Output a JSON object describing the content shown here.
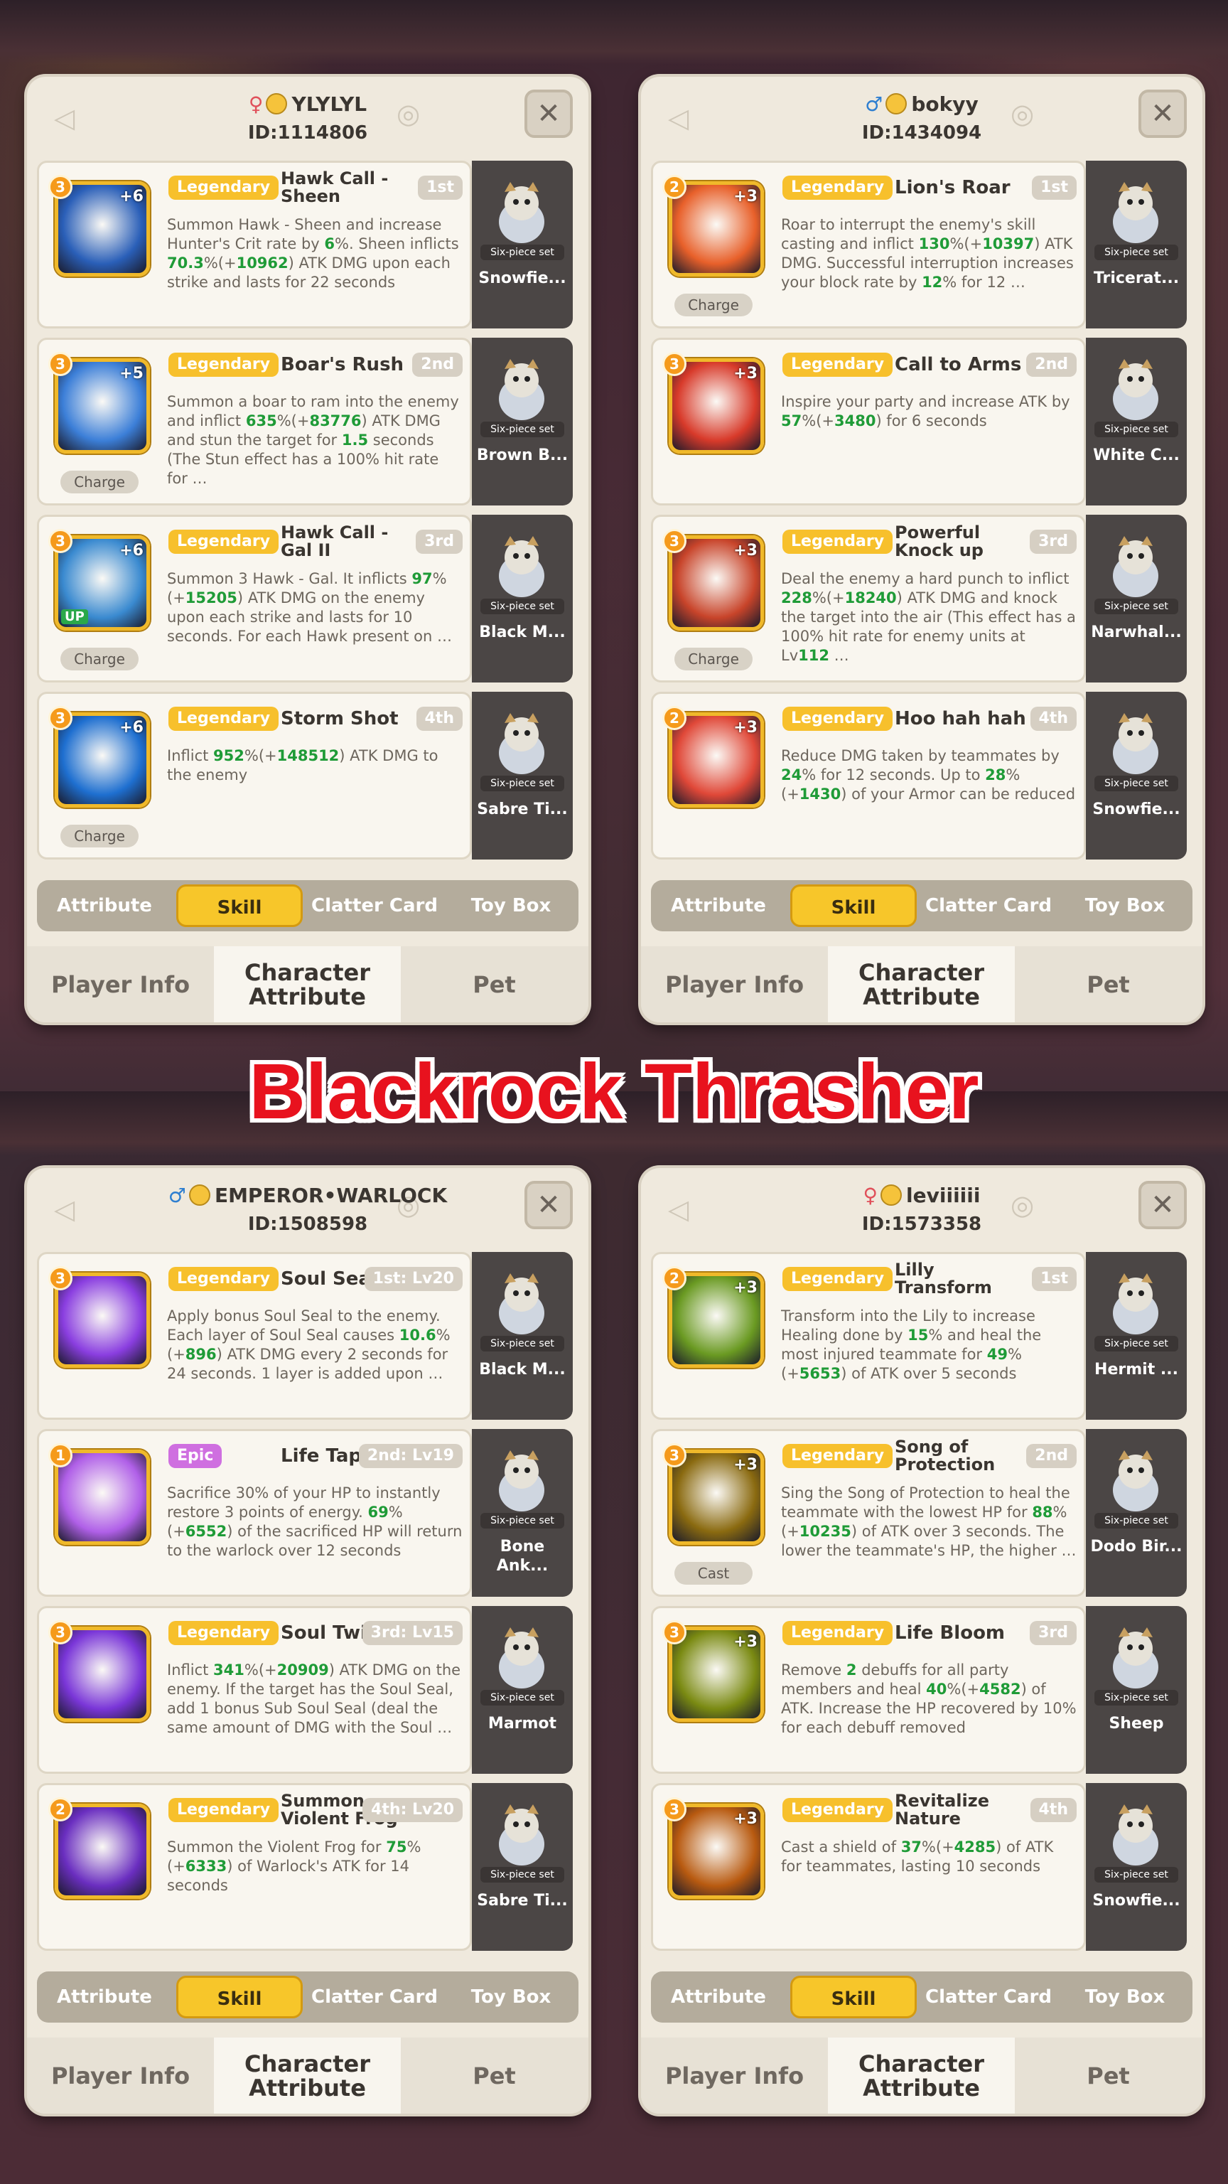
{
  "title_banner": "Blackrock Thrasher",
  "colors": {
    "legendary": "#f7c02c",
    "epic": "#cf6fe0",
    "active_tab": "#f7c62a",
    "highlight_green": "#1f9b37",
    "title_red": "#e8121e"
  },
  "tabs": [
    "Attribute",
    "Skill",
    "Clatter Card",
    "Toy Box"
  ],
  "bottom_tabs": [
    "Player Info",
    "Character Attribute",
    "Pet"
  ],
  "pet_label": "Six-piece set",
  "panels": [
    {
      "gender": "female",
      "player_name": "YLYLYL",
      "player_id": "ID:1114806",
      "skills": [
        {
          "level": "3",
          "plus": "+6",
          "rarity": "Legendary",
          "name": "Hawk Call - Sheen",
          "rank": "1st",
          "chip": "",
          "desc": [
            [
              "Summon Hawk - Sheen and increase Hunter's Crit rate by ",
              ""
            ],
            [
              "6",
              "g"
            ],
            [
              "%. Sheen inflicts ",
              ""
            ],
            [
              "70.3",
              "g"
            ],
            [
              "%(+",
              ""
            ],
            [
              "10962",
              "g"
            ],
            [
              ") ATK DMG upon each strike and lasts for 22 seconds",
              ""
            ]
          ],
          "pet": "Snowfie...",
          "icon_color": "#2a5fb8"
        },
        {
          "level": "3",
          "plus": "+5",
          "rarity": "Legendary",
          "name": "Boar's Rush",
          "rank": "2nd",
          "chip": "Charge",
          "desc": [
            [
              "Summon a boar to ram into the enemy and inflict ",
              ""
            ],
            [
              "635",
              "g"
            ],
            [
              "%(+",
              ""
            ],
            [
              "83776",
              "g"
            ],
            [
              ") ATK DMG and stun the target for ",
              ""
            ],
            [
              "1.5",
              "g"
            ],
            [
              " seconds (The Stun effect has a 100% hit rate for …",
              ""
            ]
          ],
          "pet": "Brown B...",
          "icon_color": "#3c7fd8"
        },
        {
          "level": "3",
          "plus": "+6",
          "rarity": "Legendary",
          "name": "Hawk Call - Gal II",
          "rank": "3rd",
          "chip": "Charge",
          "up": "UP",
          "desc": [
            [
              "Summon 3 Hawk - Gal. It inflicts ",
              ""
            ],
            [
              "97",
              "g"
            ],
            [
              "%(+",
              ""
            ],
            [
              "15205",
              "g"
            ],
            [
              ") ATK DMG on the enemy upon each strike and lasts for 10 seconds. For each Hawk present on …",
              ""
            ]
          ],
          "pet": "Black M...",
          "icon_color": "#3a8ad0"
        },
        {
          "level": "3",
          "plus": "+6",
          "rarity": "Legendary",
          "name": "Storm Shot",
          "rank": "4th",
          "chip": "Charge",
          "desc": [
            [
              "Inflict ",
              ""
            ],
            [
              "952",
              "g"
            ],
            [
              "%(+",
              ""
            ],
            [
              "148512",
              "g"
            ],
            [
              ") ATK DMG to the enemy",
              ""
            ]
          ],
          "pet": "Sabre Ti...",
          "icon_color": "#1e6fd0"
        }
      ]
    },
    {
      "gender": "male",
      "player_name": "bokyy",
      "player_id": "ID:1434094",
      "skills": [
        {
          "level": "2",
          "plus": "+3",
          "rarity": "Legendary",
          "name": "Lion's Roar",
          "rank": "1st",
          "chip": "Charge",
          "desc": [
            [
              "Roar to interrupt the enemy's skill casting and inflict ",
              ""
            ],
            [
              "130",
              "g"
            ],
            [
              "%(+",
              ""
            ],
            [
              "10397",
              "g"
            ],
            [
              ") ATK DMG. Successful interruption increases your block rate by ",
              ""
            ],
            [
              "12",
              "g"
            ],
            [
              "% for 12 …",
              ""
            ]
          ],
          "pet": "Tricerat...",
          "icon_color": "#e8602a"
        },
        {
          "level": "3",
          "plus": "+3",
          "rarity": "Legendary",
          "name": "Call to Arms",
          "rank": "2nd",
          "chip": "",
          "desc": [
            [
              "Inspire your party and increase ATK by ",
              ""
            ],
            [
              "57",
              "g"
            ],
            [
              "%(+",
              ""
            ],
            [
              "3480",
              "g"
            ],
            [
              ") for 6 seconds",
              ""
            ]
          ],
          "pet": "White C...",
          "icon_color": "#d83a2a"
        },
        {
          "level": "3",
          "plus": "+3",
          "rarity": "Legendary",
          "name": "Powerful Knock up",
          "rank": "3rd",
          "chip": "Charge",
          "desc": [
            [
              "Deal the enemy a hard punch to inflict ",
              ""
            ],
            [
              "228",
              "g"
            ],
            [
              "%(+",
              ""
            ],
            [
              "18240",
              "g"
            ],
            [
              ") ATK DMG and knock the target into the air (This effect has a 100% hit rate for enemy units at Lv",
              ""
            ],
            [
              "112",
              "g"
            ],
            [
              " …",
              ""
            ]
          ],
          "pet": "Narwhal...",
          "icon_color": "#c8442a"
        },
        {
          "level": "2",
          "plus": "+3",
          "rarity": "Legendary",
          "name": "Hoo hah hah",
          "rank": "4th",
          "chip": "",
          "desc": [
            [
              "Reduce DMG taken by teammates by ",
              ""
            ],
            [
              "24",
              "g"
            ],
            [
              "% for 12 seconds. Up to ",
              ""
            ],
            [
              "28",
              "g"
            ],
            [
              "%(+",
              ""
            ],
            [
              "1430",
              "g"
            ],
            [
              ") of your Armor can be reduced",
              ""
            ]
          ],
          "pet": "Snowfie...",
          "icon_color": "#e04838"
        }
      ]
    },
    {
      "gender": "male",
      "player_name": "EMPEROR•WARLOCK",
      "player_id": "ID:1508598",
      "skills": [
        {
          "level": "3",
          "plus": "",
          "rarity": "Legendary",
          "name": "Soul Seal",
          "rank": "1st: Lv20",
          "chip": "",
          "desc": [
            [
              "Apply bonus Soul Seal to the enemy. Each layer of Soul Seal causes ",
              ""
            ],
            [
              "10.6",
              "g"
            ],
            [
              "%(+",
              ""
            ],
            [
              "896",
              "g"
            ],
            [
              ") ATK DMG every 2 seconds for 24 seconds. 1 layer is added upon …",
              ""
            ]
          ],
          "pet": "Black M...",
          "icon_color": "#8a3ee0"
        },
        {
          "level": "1",
          "plus": "",
          "rarity": "Epic",
          "name": "Life Tap",
          "rank": "2nd: Lv19",
          "chip": "",
          "desc": [
            [
              "Sacrifice 30% of your HP to instantly restore 3 points of energy. ",
              ""
            ],
            [
              "69",
              "g"
            ],
            [
              "%(+",
              ""
            ],
            [
              "6552",
              "g"
            ],
            [
              ") of the sacrificed HP will return to the warlock over 12 seconds",
              ""
            ]
          ],
          "pet": "Bone Ank...",
          "icon_color": "#b060e8"
        },
        {
          "level": "3",
          "plus": "",
          "rarity": "Legendary",
          "name": "Soul Twins",
          "rank": "3rd: Lv15",
          "chip": "",
          "desc": [
            [
              "Inflict ",
              ""
            ],
            [
              "341",
              "g"
            ],
            [
              "%(+",
              ""
            ],
            [
              "20909",
              "g"
            ],
            [
              ") ATK DMG on the enemy. If the target has the Soul Seal, add 1 bonus Sub Soul Seal (deal the same amount of DMG with the Soul …",
              ""
            ]
          ],
          "pet": "Marmot",
          "icon_color": "#7a36d8"
        },
        {
          "level": "2",
          "plus": "",
          "rarity": "Legendary",
          "name": "Summon Violent Frog",
          "rank": "4th: Lv20",
          "chip": "",
          "desc": [
            [
              "Summon the Violent Frog for ",
              ""
            ],
            [
              "75",
              "g"
            ],
            [
              "%(+",
              ""
            ],
            [
              "6333",
              "g"
            ],
            [
              ") of Warlock's ATK for 14 seconds",
              ""
            ]
          ],
          "pet": "Sabre Ti...",
          "icon_color": "#6a2ec0"
        }
      ]
    },
    {
      "gender": "female",
      "player_name": "leviiiiii",
      "player_id": "ID:1573358",
      "skills": [
        {
          "level": "2",
          "plus": "+3",
          "rarity": "Legendary",
          "name": "Lilly Transform",
          "rank": "1st",
          "chip": "",
          "desc": [
            [
              "Transform into the Lily to increase Healing done by ",
              ""
            ],
            [
              "15",
              "g"
            ],
            [
              "% and heal the most injured teammate for ",
              ""
            ],
            [
              "49",
              "g"
            ],
            [
              "%(+",
              ""
            ],
            [
              "5653",
              "g"
            ],
            [
              ") of ATK over 5 seconds",
              ""
            ]
          ],
          "pet": "Hermit ...",
          "icon_color": "#6a9a22"
        },
        {
          "level": "3",
          "plus": "+3",
          "rarity": "Legendary",
          "name": "Song of Protection",
          "rank": "2nd",
          "chip": "Cast",
          "desc": [
            [
              "Sing the Song of Protection to heal the teammate with the lowest HP for ",
              ""
            ],
            [
              "88",
              "g"
            ],
            [
              "%(+",
              ""
            ],
            [
              "10235",
              "g"
            ],
            [
              ") of ATK over 3 seconds. The lower the teammate's HP, the higher …",
              ""
            ]
          ],
          "pet": "Dodo Bir...",
          "icon_color": "#8a6a10"
        },
        {
          "level": "3",
          "plus": "+3",
          "rarity": "Legendary",
          "name": "Life Bloom",
          "rank": "3rd",
          "chip": "",
          "desc": [
            [
              "Remove ",
              ""
            ],
            [
              "2",
              "g"
            ],
            [
              " debuffs for all party members and heal ",
              ""
            ],
            [
              "40",
              "g"
            ],
            [
              "%(+",
              ""
            ],
            [
              "4582",
              "g"
            ],
            [
              ") of ATK. Increase the HP recovered by 10% for each debuff removed",
              ""
            ]
          ],
          "pet": "Sheep",
          "icon_color": "#7a8a12"
        },
        {
          "level": "3",
          "plus": "+3",
          "rarity": "Legendary",
          "name": "Revitalize Nature",
          "rank": "4th",
          "chip": "",
          "desc": [
            [
              "Cast a shield of ",
              ""
            ],
            [
              "37",
              "g"
            ],
            [
              "%(+",
              ""
            ],
            [
              "4285",
              "g"
            ],
            [
              ") of ATK for teammates, lasting 10 seconds",
              ""
            ]
          ],
          "pet": "Snowfie...",
          "icon_color": "#b85a10"
        }
      ]
    }
  ]
}
